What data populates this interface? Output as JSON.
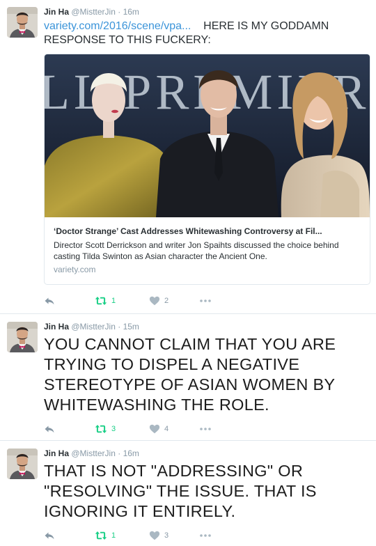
{
  "tweets": [
    {
      "name": "Jin Ha",
      "handle": "@MistterJin",
      "time": "· 16m",
      "link_text": "variety.com/2016/scene/vpa...",
      "text": "HERE IS MY GODDAMN RESPONSE TO THIS FUCKERY:",
      "card": {
        "title": "‘Doctor Strange’ Cast Addresses Whitewashing Controversy at Fil...",
        "description": "Director Scott Derrickson and writer Jon Spaihts discussed the choice behind casting Tilda Swinton as Asian character the Ancient One.",
        "domain": "variety.com",
        "banner_text": "LL PREMIER"
      },
      "retweets": "1",
      "likes": "2"
    },
    {
      "name": "Jin Ha",
      "handle": "@MistterJin",
      "time": "· 15m",
      "text": "YOU CANNOT CLAIM THAT YOU ARE TRYING TO DISPEL A NEGATIVE STEREOTYPE OF ASIAN WOMEN BY WHITEWASHING THE ROLE.",
      "retweets": "3",
      "likes": "4"
    },
    {
      "name": "Jin Ha",
      "handle": "@MistterJin",
      "time": "· 16m",
      "text": "THAT IS NOT \"ADDRESSING\" OR \"RESOLVING\" THE ISSUE. THAT IS IGNORING IT ENTIRELY.",
      "retweets": "1",
      "likes": "3"
    }
  ],
  "icons": {
    "reply": "reply-icon",
    "retweet": "retweet-icon",
    "like": "heart-icon",
    "more": "more-icon"
  },
  "colors": {
    "link": "#3b94d9",
    "retweet_active": "#19cf86",
    "muted": "#8899a6",
    "divider": "#e1e8ed"
  }
}
